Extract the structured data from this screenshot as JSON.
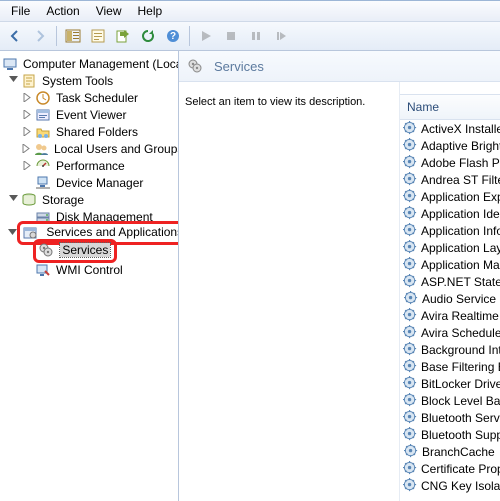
{
  "menu": {
    "file": "File",
    "action": "Action",
    "view": "View",
    "help": "Help"
  },
  "tree": {
    "root": "Computer Management (Local",
    "systools": "System Tools",
    "tasksched": "Task Scheduler",
    "eventviewer": "Event Viewer",
    "shared": "Shared Folders",
    "localusers": "Local Users and Groups",
    "perf": "Performance",
    "devmgr": "Device Manager",
    "storage": "Storage",
    "diskmgmt": "Disk Management",
    "svcapps": "Services and Applications",
    "services": "Services",
    "wmi": "WMI Control"
  },
  "header": {
    "title": "Services"
  },
  "description": "Select an item to view its description.",
  "list": {
    "header": "Name",
    "items": [
      "ActiveX Installer (AxI",
      "Adaptive Brightness",
      "Adobe Flash Player U",
      "Andrea ST Filters Ser",
      "Application Experien",
      "Application Identity",
      "Application Informa",
      "Application Layer Ga",
      "Application Manage",
      "ASP.NET State Servic",
      "Audio Service",
      "Avira Realtime Prote",
      "Avira Scheduler",
      "Background Intellige",
      "Base Filtering Engine",
      "BitLocker Drive Encry",
      "Block Level Backup E",
      "Bluetooth Service",
      "Bluetooth Support S",
      "BranchCache",
      "Certificate Propagati",
      "CNG Key Isolation"
    ]
  }
}
